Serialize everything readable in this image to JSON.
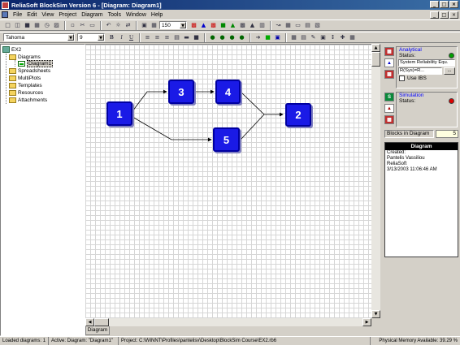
{
  "window": {
    "title": "ReliaSoft BlockSim Version 6 - [Diagram: Diagram1]",
    "controls": [
      "_",
      "□",
      "×"
    ]
  },
  "menu": {
    "items": [
      "File",
      "Edit",
      "View",
      "Project",
      "Diagram",
      "Tools",
      "Window",
      "Help"
    ],
    "mdi_controls": [
      "_",
      "□",
      "×"
    ]
  },
  "toolbar": {
    "zoom_value": "150",
    "font_name": "Tahoma",
    "font_size": "9",
    "bold": "B",
    "italic": "I",
    "underline": "U"
  },
  "tree": {
    "root": "EX2",
    "items": [
      {
        "label": "Diagrams"
      },
      {
        "label": "Diagram1"
      },
      {
        "label": "Spreadsheets"
      },
      {
        "label": "MultiPlots"
      },
      {
        "label": "Templates"
      },
      {
        "label": "Resources"
      },
      {
        "label": "Attachments"
      }
    ]
  },
  "diagram": {
    "blocks": [
      {
        "id": "1",
        "label": "1"
      },
      {
        "id": "3",
        "label": "3"
      },
      {
        "id": "4",
        "label": "4"
      },
      {
        "id": "5",
        "label": "5"
      },
      {
        "id": "2",
        "label": "2"
      }
    ],
    "sheet_tab": "Diagram"
  },
  "analytical": {
    "title": "Analytical",
    "status_label": "Status:",
    "status_color": "#00a000",
    "dropdown": "System Reliability Equ.",
    "equation": "R(Sys)=R...",
    "dots": "...",
    "use_ibs": "Use IBS"
  },
  "simulation": {
    "title": "Simulation",
    "status_label": "Status:",
    "status_color": "#e00000"
  },
  "blocks_in_diagram": {
    "label": "Blocks in Diagram",
    "value": "5"
  },
  "info": {
    "header": "Diagram",
    "lines": [
      "Created:",
      "Pantelis Vassiliou",
      "ReliaSoft",
      "3/13/2003 11:06:46 AM"
    ]
  },
  "statusbar": {
    "loaded": "Loaded diagrams: 1",
    "active": "Active: Diagram: \"Diagram1\"",
    "project": "Project: C:\\WINNT\\Profiles\\pantelisv\\Desktop\\BlockSim Course\\EX2.rb6",
    "memory": "Physical Memory Available: 39.29 %"
  },
  "icons": {
    "toolbar1": [
      "new-icon",
      "open-icon",
      "save-icon",
      "print-icon",
      "preview-icon",
      "project-icon",
      "copy-icon",
      "cut-icon",
      "paste-icon",
      "undo-icon",
      "find-icon",
      "replace-icon",
      "diagram-view-icon",
      "grid-icon"
    ],
    "toolbar2": [
      "align-left-icon",
      "align-center-icon",
      "align-right-icon",
      "connect-icon",
      "block-icon",
      "lock-icon"
    ]
  },
  "colors": {
    "block_fill": "#1a1ae6",
    "title_bar": "#0a246a",
    "analytical_title": "#0000ff"
  }
}
